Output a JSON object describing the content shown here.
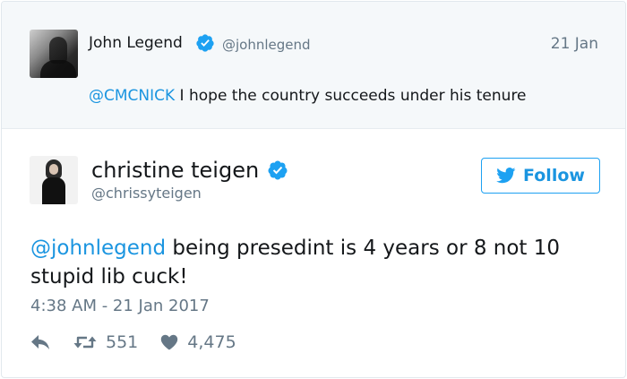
{
  "parent_tweet": {
    "author_name": "John Legend",
    "handle": "@johnlegend",
    "date": "21 Jan",
    "mention": "@CMCNICK",
    "text": " I hope the country succeeds under his tenure"
  },
  "main_tweet": {
    "author_name": "christine teigen",
    "handle": "@chrissyteigen",
    "follow_label": "Follow",
    "mention": "@johnlegend",
    "text": " being presedint is 4 years or 8 not 10 stupid lib cuck!",
    "timestamp": "4:38 AM - 21 Jan 2017",
    "retweet_count": "551",
    "like_count": "4,475"
  },
  "icons": {
    "verified": "verified-badge-icon",
    "follow": "twitter-bird-icon",
    "reply": "reply-arrow-icon",
    "retweet": "retweet-icon",
    "like": "heart-icon"
  },
  "colors": {
    "link": "#1b95e0",
    "verified": "#1da1f2",
    "muted_text": "#657786",
    "parent_background": "#f5f8fa"
  }
}
